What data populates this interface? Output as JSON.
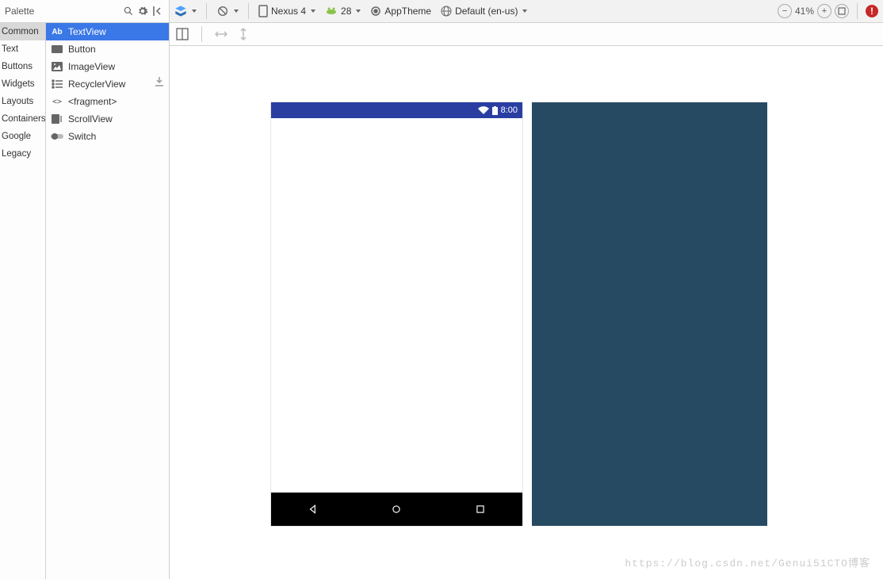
{
  "palette": {
    "title": "Palette",
    "categories": [
      "Common",
      "Text",
      "Buttons",
      "Widgets",
      "Layouts",
      "Containers",
      "Google",
      "Legacy"
    ],
    "selected_category": "Common",
    "components": [
      {
        "label": "TextView",
        "icon": "text-ab-icon"
      },
      {
        "label": "Button",
        "icon": "button-icon"
      },
      {
        "label": "ImageView",
        "icon": "image-icon"
      },
      {
        "label": "RecyclerView",
        "icon": "list-icon"
      },
      {
        "label": "<fragment>",
        "icon": "fragment-icon"
      },
      {
        "label": "ScrollView",
        "icon": "scroll-icon"
      },
      {
        "label": "Switch",
        "icon": "switch-icon"
      }
    ],
    "selected_component": "TextView"
  },
  "toolbar": {
    "device": "Nexus 4",
    "api": "28",
    "theme": "AppTheme",
    "locale": "Default (en-us)",
    "zoom": "41%"
  },
  "device_preview": {
    "status_time": "8:00"
  },
  "watermark": "https://blog.csdn.net/Genui51CTO博客"
}
